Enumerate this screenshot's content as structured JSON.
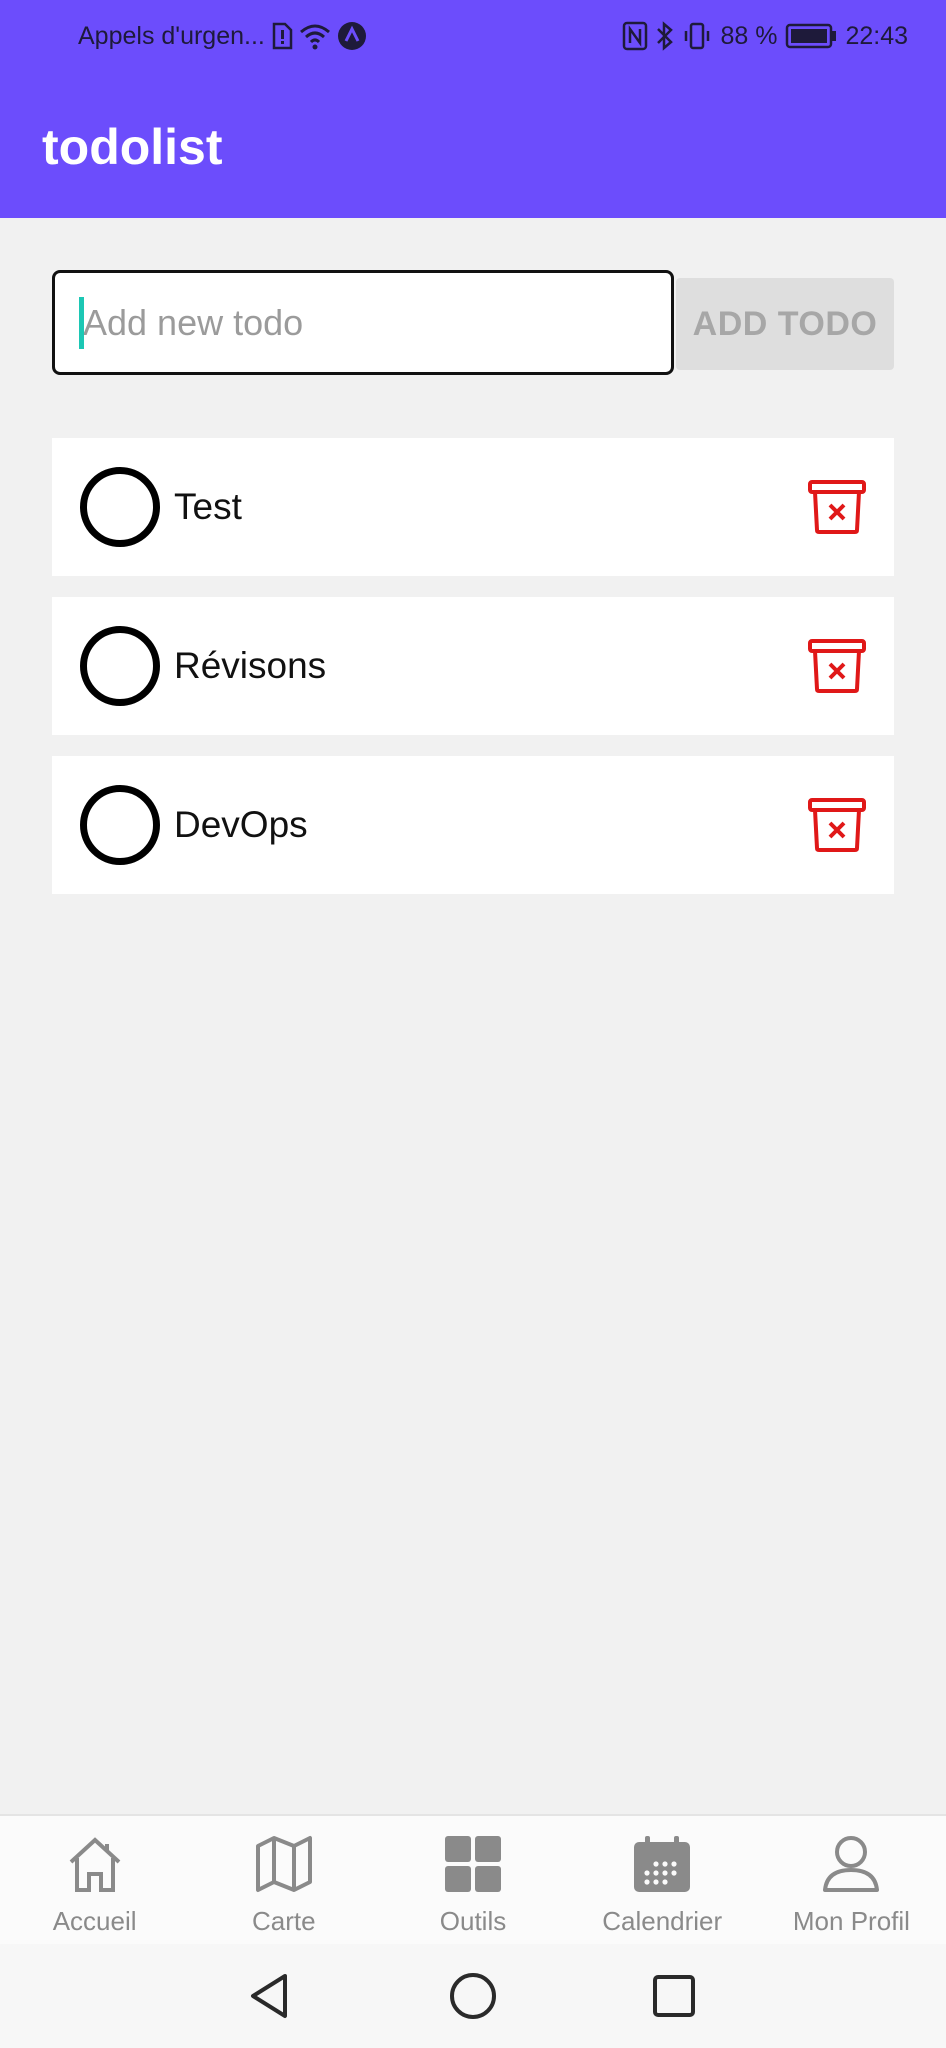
{
  "status_bar": {
    "carrier_text": "Appels d'urgen...",
    "battery_text": "88 %",
    "time": "22:43"
  },
  "app_bar": {
    "title": "todolist",
    "background_color": "#6c4dfc"
  },
  "new_todo": {
    "placeholder": "Add new todo",
    "value": "",
    "add_button_label": "ADD TODO"
  },
  "todos": [
    {
      "label": "Test",
      "done": false
    },
    {
      "label": "Révisons",
      "done": false
    },
    {
      "label": "DevOps",
      "done": false
    }
  ],
  "bottom_nav": {
    "items": [
      {
        "label": "Accueil",
        "icon": "home-icon"
      },
      {
        "label": "Carte",
        "icon": "map-icon"
      },
      {
        "label": "Outils",
        "icon": "grid-icon"
      },
      {
        "label": "Calendrier",
        "icon": "calendar-icon"
      },
      {
        "label": "Mon Profil",
        "icon": "profile-icon"
      }
    ]
  },
  "colors": {
    "accent": "#6c4dfc",
    "delete": "#e01818",
    "caret": "#1cc7b4"
  }
}
